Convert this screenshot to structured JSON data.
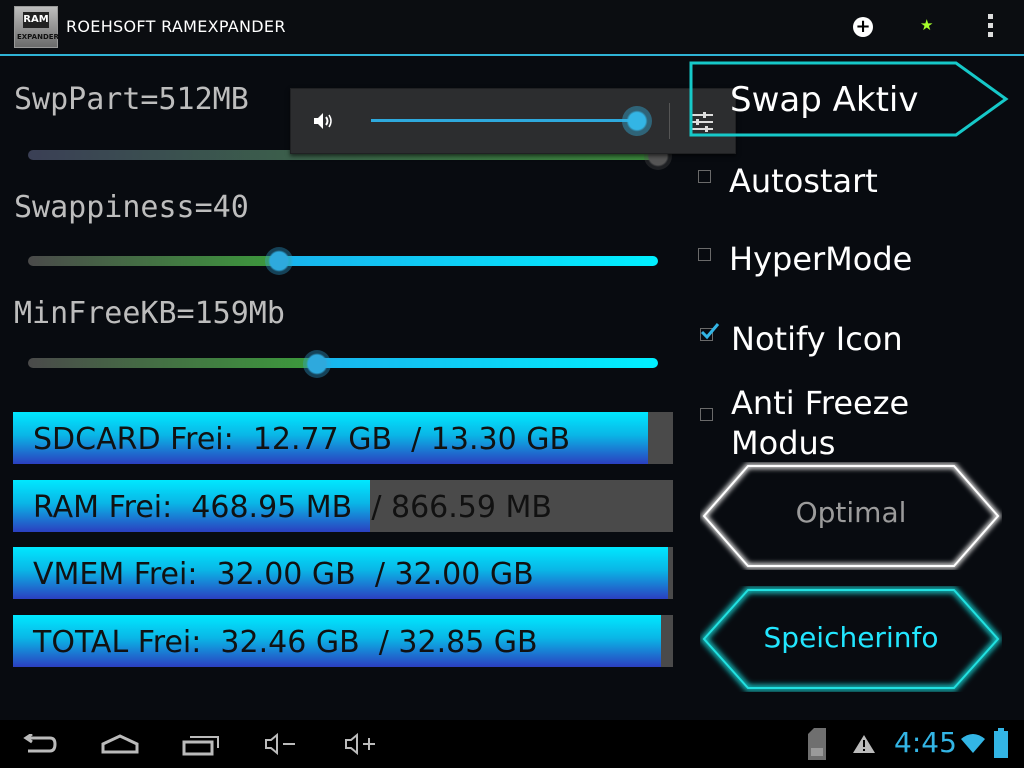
{
  "app": {
    "title": "ROEHSOFT RAMEXPANDER",
    "icon_text_top": "RAM",
    "icon_text_bottom": "EXPANDER"
  },
  "actionbar": {
    "icons": [
      "add-circle-icon",
      "star-icon",
      "overflow-menu-icon"
    ]
  },
  "sliders": [
    {
      "label": "SwpPart=512MB",
      "value_fraction": 1.0
    },
    {
      "label": "Swappiness=40",
      "value_fraction": 0.4
    },
    {
      "label": "MinFreeKB=159Mb",
      "value_fraction": 0.46
    }
  ],
  "volume_popup": {
    "level_fraction": 0.95,
    "icons": [
      "speaker-icon",
      "equalizer-settings-icon"
    ]
  },
  "storage": [
    {
      "label": "SDCARD Frei:  12.77 GB  / 13.30 GB",
      "fill_fraction": 0.96
    },
    {
      "label": "RAM Frei:  468.95 MB  / 866.59 MB",
      "fill_fraction": 0.54
    },
    {
      "label": "VMEM Frei:  32.00 GB  / 32.00 GB",
      "fill_fraction": 0.99
    },
    {
      "label": "TOTAL Frei:  32.46 GB  / 32.85 GB",
      "fill_fraction": 0.98
    }
  ],
  "right_panel": {
    "swap_button": "Swap Aktiv",
    "options": [
      {
        "label": "Autostart",
        "checked": false
      },
      {
        "label": "HyperMode",
        "checked": false
      },
      {
        "label": "Notify Icon",
        "checked": true
      },
      {
        "label": "Anti Freeze",
        "label2": "Modus",
        "checked": false
      }
    ],
    "optimal_button": "Optimal",
    "speicherinfo_button": "Speicherinfo"
  },
  "colors": {
    "accent": "#33b5e5",
    "cyan": "#00e8ff",
    "swap_border": "#16c9c9"
  },
  "navbar": {
    "icons": [
      "back-icon",
      "home-icon",
      "recent-apps-icon",
      "volume-down-icon",
      "volume-up-icon",
      "sd-card-icon",
      "warning-icon",
      "wifi-icon",
      "battery-icon"
    ],
    "time": "4:45"
  }
}
